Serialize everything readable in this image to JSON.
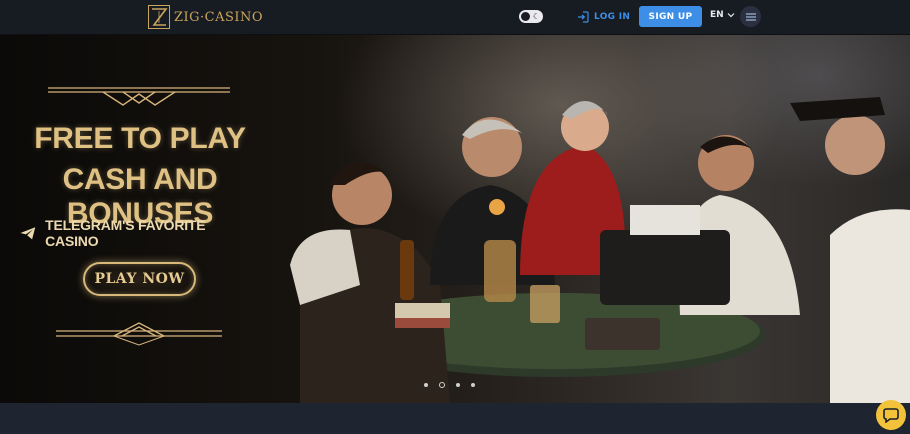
{
  "header": {
    "logo_text": "ZIG·CASINO",
    "login_label": "LOG IN",
    "signup_label": "SIGN UP",
    "language": "EN"
  },
  "hero": {
    "headline_line1": "FREE TO PLAY",
    "headline_line2": "CASH AND BONUSES",
    "tagline": "TELEGRAM'S FAVORITE CASINO",
    "cta_label": "PLAY NOW",
    "slides_total": 4,
    "slide_active": 2
  },
  "colors": {
    "accent_blue": "#3c8ee6",
    "gold": "#e0c184",
    "chat_yellow": "#f2c23b",
    "topbar_bg": "#171b22"
  },
  "icons": {
    "theme": "moon-icon",
    "login": "login-arrow-icon",
    "language": "chevron-down-icon",
    "menu": "hamburger-icon",
    "tagline": "telegram-icon",
    "chat": "chat-bubble-icon"
  }
}
